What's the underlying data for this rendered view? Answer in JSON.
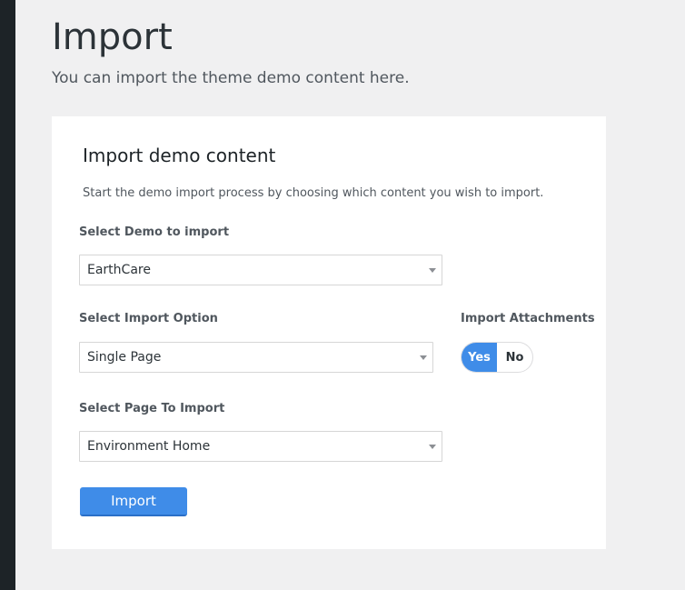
{
  "page": {
    "title": "Import",
    "subtitle": "You can import the theme demo content here."
  },
  "card": {
    "title": "Import demo content",
    "description": "Start the demo import process by choosing which content you wish to import."
  },
  "fields": {
    "demo": {
      "label": "Select Demo to import",
      "value": "EarthCare"
    },
    "import_option": {
      "label": "Select Import Option",
      "value": "Single Page"
    },
    "attachments": {
      "label": "Import Attachments",
      "yes_label": "Yes",
      "no_label": "No",
      "selected": "Yes"
    },
    "page_to_import": {
      "label": "Select Page To Import",
      "value": "Environment Home"
    }
  },
  "actions": {
    "import_label": "Import"
  },
  "colors": {
    "accent": "#3f8ce8",
    "sidebar": "#1d2327",
    "background": "#f0f0f1"
  }
}
